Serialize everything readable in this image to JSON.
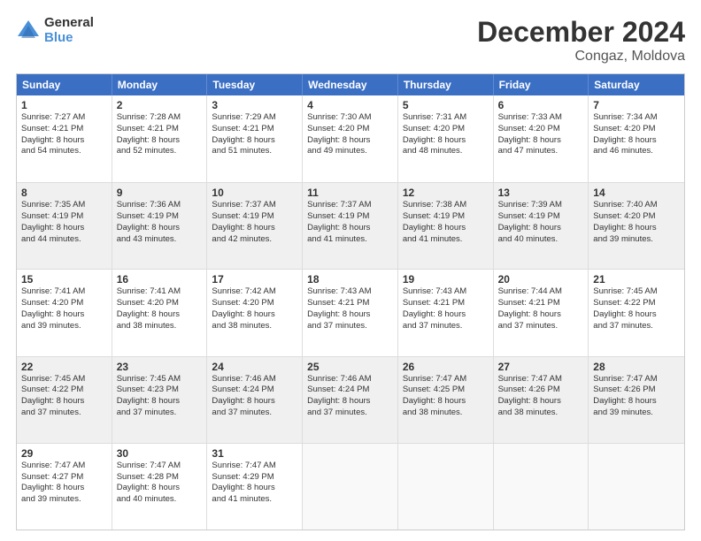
{
  "logo": {
    "general": "General",
    "blue": "Blue"
  },
  "title": "December 2024",
  "subtitle": "Congaz, Moldova",
  "weekdays": [
    "Sunday",
    "Monday",
    "Tuesday",
    "Wednesday",
    "Thursday",
    "Friday",
    "Saturday"
  ],
  "rows": [
    [
      {
        "day": "1",
        "sunrise": "Sunrise: 7:27 AM",
        "sunset": "Sunset: 4:21 PM",
        "daylight": "Daylight: 8 hours",
        "minutes": "and 54 minutes.",
        "shaded": false
      },
      {
        "day": "2",
        "sunrise": "Sunrise: 7:28 AM",
        "sunset": "Sunset: 4:21 PM",
        "daylight": "Daylight: 8 hours",
        "minutes": "and 52 minutes.",
        "shaded": false
      },
      {
        "day": "3",
        "sunrise": "Sunrise: 7:29 AM",
        "sunset": "Sunset: 4:21 PM",
        "daylight": "Daylight: 8 hours",
        "minutes": "and 51 minutes.",
        "shaded": false
      },
      {
        "day": "4",
        "sunrise": "Sunrise: 7:30 AM",
        "sunset": "Sunset: 4:20 PM",
        "daylight": "Daylight: 8 hours",
        "minutes": "and 49 minutes.",
        "shaded": false
      },
      {
        "day": "5",
        "sunrise": "Sunrise: 7:31 AM",
        "sunset": "Sunset: 4:20 PM",
        "daylight": "Daylight: 8 hours",
        "minutes": "and 48 minutes.",
        "shaded": false
      },
      {
        "day": "6",
        "sunrise": "Sunrise: 7:33 AM",
        "sunset": "Sunset: 4:20 PM",
        "daylight": "Daylight: 8 hours",
        "minutes": "and 47 minutes.",
        "shaded": false
      },
      {
        "day": "7",
        "sunrise": "Sunrise: 7:34 AM",
        "sunset": "Sunset: 4:20 PM",
        "daylight": "Daylight: 8 hours",
        "minutes": "and 46 minutes.",
        "shaded": false
      }
    ],
    [
      {
        "day": "8",
        "sunrise": "Sunrise: 7:35 AM",
        "sunset": "Sunset: 4:19 PM",
        "daylight": "Daylight: 8 hours",
        "minutes": "and 44 minutes.",
        "shaded": true
      },
      {
        "day": "9",
        "sunrise": "Sunrise: 7:36 AM",
        "sunset": "Sunset: 4:19 PM",
        "daylight": "Daylight: 8 hours",
        "minutes": "and 43 minutes.",
        "shaded": true
      },
      {
        "day": "10",
        "sunrise": "Sunrise: 7:37 AM",
        "sunset": "Sunset: 4:19 PM",
        "daylight": "Daylight: 8 hours",
        "minutes": "and 42 minutes.",
        "shaded": true
      },
      {
        "day": "11",
        "sunrise": "Sunrise: 7:37 AM",
        "sunset": "Sunset: 4:19 PM",
        "daylight": "Daylight: 8 hours",
        "minutes": "and 41 minutes.",
        "shaded": true
      },
      {
        "day": "12",
        "sunrise": "Sunrise: 7:38 AM",
        "sunset": "Sunset: 4:19 PM",
        "daylight": "Daylight: 8 hours",
        "minutes": "and 41 minutes.",
        "shaded": true
      },
      {
        "day": "13",
        "sunrise": "Sunrise: 7:39 AM",
        "sunset": "Sunset: 4:19 PM",
        "daylight": "Daylight: 8 hours",
        "minutes": "and 40 minutes.",
        "shaded": true
      },
      {
        "day": "14",
        "sunrise": "Sunrise: 7:40 AM",
        "sunset": "Sunset: 4:20 PM",
        "daylight": "Daylight: 8 hours",
        "minutes": "and 39 minutes.",
        "shaded": true
      }
    ],
    [
      {
        "day": "15",
        "sunrise": "Sunrise: 7:41 AM",
        "sunset": "Sunset: 4:20 PM",
        "daylight": "Daylight: 8 hours",
        "minutes": "and 39 minutes.",
        "shaded": false
      },
      {
        "day": "16",
        "sunrise": "Sunrise: 7:41 AM",
        "sunset": "Sunset: 4:20 PM",
        "daylight": "Daylight: 8 hours",
        "minutes": "and 38 minutes.",
        "shaded": false
      },
      {
        "day": "17",
        "sunrise": "Sunrise: 7:42 AM",
        "sunset": "Sunset: 4:20 PM",
        "daylight": "Daylight: 8 hours",
        "minutes": "and 38 minutes.",
        "shaded": false
      },
      {
        "day": "18",
        "sunrise": "Sunrise: 7:43 AM",
        "sunset": "Sunset: 4:21 PM",
        "daylight": "Daylight: 8 hours",
        "minutes": "and 37 minutes.",
        "shaded": false
      },
      {
        "day": "19",
        "sunrise": "Sunrise: 7:43 AM",
        "sunset": "Sunset: 4:21 PM",
        "daylight": "Daylight: 8 hours",
        "minutes": "and 37 minutes.",
        "shaded": false
      },
      {
        "day": "20",
        "sunrise": "Sunrise: 7:44 AM",
        "sunset": "Sunset: 4:21 PM",
        "daylight": "Daylight: 8 hours",
        "minutes": "and 37 minutes.",
        "shaded": false
      },
      {
        "day": "21",
        "sunrise": "Sunrise: 7:45 AM",
        "sunset": "Sunset: 4:22 PM",
        "daylight": "Daylight: 8 hours",
        "minutes": "and 37 minutes.",
        "shaded": false
      }
    ],
    [
      {
        "day": "22",
        "sunrise": "Sunrise: 7:45 AM",
        "sunset": "Sunset: 4:22 PM",
        "daylight": "Daylight: 8 hours",
        "minutes": "and 37 minutes.",
        "shaded": true
      },
      {
        "day": "23",
        "sunrise": "Sunrise: 7:45 AM",
        "sunset": "Sunset: 4:23 PM",
        "daylight": "Daylight: 8 hours",
        "minutes": "and 37 minutes.",
        "shaded": true
      },
      {
        "day": "24",
        "sunrise": "Sunrise: 7:46 AM",
        "sunset": "Sunset: 4:24 PM",
        "daylight": "Daylight: 8 hours",
        "minutes": "and 37 minutes.",
        "shaded": true
      },
      {
        "day": "25",
        "sunrise": "Sunrise: 7:46 AM",
        "sunset": "Sunset: 4:24 PM",
        "daylight": "Daylight: 8 hours",
        "minutes": "and 37 minutes.",
        "shaded": true
      },
      {
        "day": "26",
        "sunrise": "Sunrise: 7:47 AM",
        "sunset": "Sunset: 4:25 PM",
        "daylight": "Daylight: 8 hours",
        "minutes": "and 38 minutes.",
        "shaded": true
      },
      {
        "day": "27",
        "sunrise": "Sunrise: 7:47 AM",
        "sunset": "Sunset: 4:26 PM",
        "daylight": "Daylight: 8 hours",
        "minutes": "and 38 minutes.",
        "shaded": true
      },
      {
        "day": "28",
        "sunrise": "Sunrise: 7:47 AM",
        "sunset": "Sunset: 4:26 PM",
        "daylight": "Daylight: 8 hours",
        "minutes": "and 39 minutes.",
        "shaded": true
      }
    ],
    [
      {
        "day": "29",
        "sunrise": "Sunrise: 7:47 AM",
        "sunset": "Sunset: 4:27 PM",
        "daylight": "Daylight: 8 hours",
        "minutes": "and 39 minutes.",
        "shaded": false
      },
      {
        "day": "30",
        "sunrise": "Sunrise: 7:47 AM",
        "sunset": "Sunset: 4:28 PM",
        "daylight": "Daylight: 8 hours",
        "minutes": "and 40 minutes.",
        "shaded": false
      },
      {
        "day": "31",
        "sunrise": "Sunrise: 7:47 AM",
        "sunset": "Sunset: 4:29 PM",
        "daylight": "Daylight: 8 hours",
        "minutes": "and 41 minutes.",
        "shaded": false
      },
      {
        "day": "",
        "sunrise": "",
        "sunset": "",
        "daylight": "",
        "minutes": "",
        "shaded": false,
        "empty": true
      },
      {
        "day": "",
        "sunrise": "",
        "sunset": "",
        "daylight": "",
        "minutes": "",
        "shaded": false,
        "empty": true
      },
      {
        "day": "",
        "sunrise": "",
        "sunset": "",
        "daylight": "",
        "minutes": "",
        "shaded": false,
        "empty": true
      },
      {
        "day": "",
        "sunrise": "",
        "sunset": "",
        "daylight": "",
        "minutes": "",
        "shaded": false,
        "empty": true
      }
    ]
  ]
}
